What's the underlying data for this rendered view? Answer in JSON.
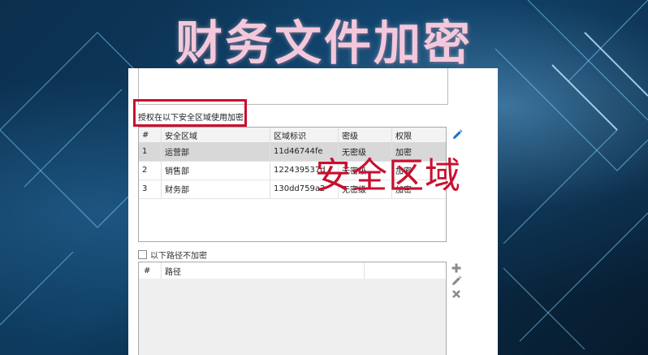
{
  "headline": "财务文件加密",
  "auth_label": "授权在以下安全区域使用加密:",
  "overlay_caption": "安全区域",
  "zone_table": {
    "columns": [
      "#",
      "安全区域",
      "区域标识",
      "密级",
      "权限"
    ],
    "rows": [
      {
        "num": "1",
        "name": "运营部",
        "id": "11d46744fe",
        "level": "无密级",
        "perm": "加密",
        "selected": true
      },
      {
        "num": "2",
        "name": "销售部",
        "id": "122439537d",
        "level": "无密级",
        "perm": "加密",
        "selected": false
      },
      {
        "num": "3",
        "name": "财务部",
        "id": "130dd759a2",
        "level": "无密级",
        "perm": "加密",
        "selected": false
      }
    ]
  },
  "no_encrypt_checkbox": {
    "label": "以下路径不加密",
    "checked": false
  },
  "path_table": {
    "columns": [
      "#",
      "路径"
    ]
  },
  "icons": {
    "edit_zone": "pencil-icon",
    "add_path": "plus-icon",
    "edit_path": "pencil-icon",
    "delete_path": "close-icon"
  },
  "colors": {
    "highlight": "#c8102e",
    "accent_icon": "#1a73c8",
    "headline": "#f4c8dc"
  }
}
